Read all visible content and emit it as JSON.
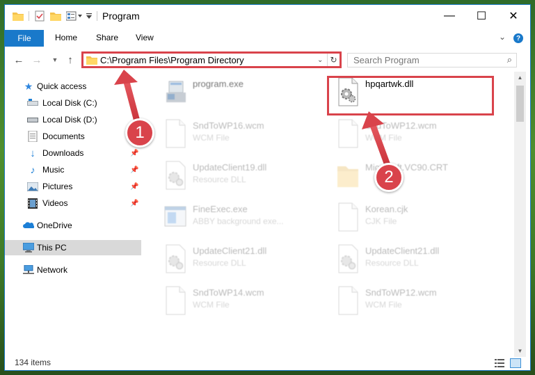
{
  "window": {
    "title": "Program",
    "controls": {
      "minimize": "—",
      "maximize": "☐",
      "close": "✕"
    }
  },
  "ribbon": {
    "tabs": [
      "File",
      "Home",
      "Share",
      "View"
    ],
    "help": "?"
  },
  "navigation": {
    "address": "C:\\Program Files\\Program Directory",
    "search_placeholder": "Search Program"
  },
  "sidebar": {
    "items": [
      {
        "label": "Quick access",
        "icon": "star-icon",
        "pinned": false
      },
      {
        "label": "Local Disk (C:)",
        "icon": "drive-icon",
        "pinned": false
      },
      {
        "label": "Local Disk (D:)",
        "icon": "drive-icon",
        "pinned": false
      },
      {
        "label": "Documents",
        "icon": "documents-icon",
        "pinned": true
      },
      {
        "label": "Downloads",
        "icon": "downloads-icon",
        "pinned": true
      },
      {
        "label": "Music",
        "icon": "music-icon",
        "pinned": true
      },
      {
        "label": "Pictures",
        "icon": "pictures-icon",
        "pinned": true
      },
      {
        "label": "Videos",
        "icon": "videos-icon",
        "pinned": true
      },
      {
        "label": "OneDrive",
        "icon": "onedrive-icon",
        "pinned": false
      },
      {
        "label": "This PC",
        "icon": "this-pc-icon",
        "pinned": false,
        "selected": true
      },
      {
        "label": "Network",
        "icon": "network-icon",
        "pinned": false
      }
    ]
  },
  "files": [
    {
      "name": "program.exe",
      "type": "",
      "icon": "exe-icon"
    },
    {
      "name": "hpqartwk.dll",
      "type": "",
      "icon": "dll-gear-icon",
      "highlighted": true
    },
    {
      "name": "SndToWP16.wcm",
      "type": "WCM File",
      "icon": "blank-file-icon"
    },
    {
      "name": "SndToWP12.wcm",
      "type": "WCM File",
      "icon": "blank-file-icon"
    },
    {
      "name": "UpdateClient19.dll",
      "type": "Resource DLL",
      "icon": "dll-gear-icon"
    },
    {
      "name": "Microsoft.VC90.CRT",
      "type": "",
      "icon": "folder-icon"
    },
    {
      "name": "FineExec.exe",
      "type": "ABBY background exe...",
      "icon": "exe-window-icon"
    },
    {
      "name": "Korean.cjk",
      "type": "CJK File",
      "icon": "blank-file-icon"
    },
    {
      "name": "UpdateClient21.dll",
      "type": "Resource DLL",
      "icon": "dll-gear-icon"
    },
    {
      "name": "UpdateClient21.dll",
      "type": "Resource DLL",
      "icon": "dll-gear-icon"
    },
    {
      "name": "SndToWP14.wcm",
      "type": "WCM File",
      "icon": "blank-file-icon"
    },
    {
      "name": "SndToWP12.wcm",
      "type": "WCM File",
      "icon": "blank-file-icon"
    }
  ],
  "status": {
    "item_count": "134 items"
  },
  "annotations": {
    "step1": "1",
    "step2": "2"
  },
  "colors": {
    "accent": "#1979ca",
    "highlight": "#d9434b",
    "selected_bg": "#d9d9d9"
  }
}
